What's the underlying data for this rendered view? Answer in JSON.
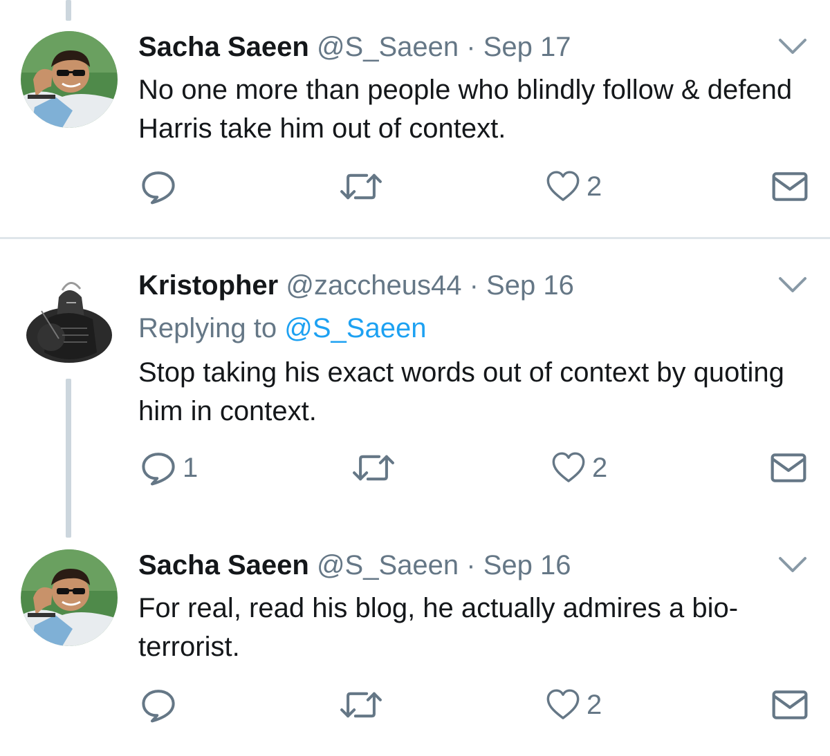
{
  "tweets": [
    {
      "name": "Sacha Saeen",
      "handle": "@S_Saeen",
      "separator": "·",
      "date": "Sep 17",
      "text": "No one more than people who blindly follow & defend Harris take him out of context.",
      "reply_count": "",
      "retweet_count": "",
      "like_count": "2",
      "avatar_icon": "person-sunglasses-avatar"
    },
    {
      "name": "Kristopher",
      "handle": "@zaccheus44",
      "separator": "·",
      "date": "Sep 16",
      "replying_prefix": "Replying to",
      "replying_to": "@S_Saeen",
      "text": "Stop taking his exact words out of context by quoting him in context.",
      "reply_count": "1",
      "retweet_count": "",
      "like_count": "2",
      "avatar_icon": "armored-knight-avatar"
    },
    {
      "name": "Sacha Saeen",
      "handle": "@S_Saeen",
      "separator": "·",
      "date": "Sep 16",
      "text": "For real, read his blog, he actually admires a bio-terrorist.",
      "reply_count": "",
      "retweet_count": "",
      "like_count": "2",
      "avatar_icon": "person-sunglasses-avatar"
    }
  ],
  "icons": {
    "reply": "reply-icon",
    "retweet": "retweet-icon",
    "like": "heart-icon",
    "dm": "envelope-icon",
    "menu": "chevron-down-icon"
  },
  "colors": {
    "text": "#14171a",
    "secondary": "#657786",
    "link": "#1da1f2",
    "thread_line": "#ccd6dd",
    "divider": "#dfe5ea"
  }
}
